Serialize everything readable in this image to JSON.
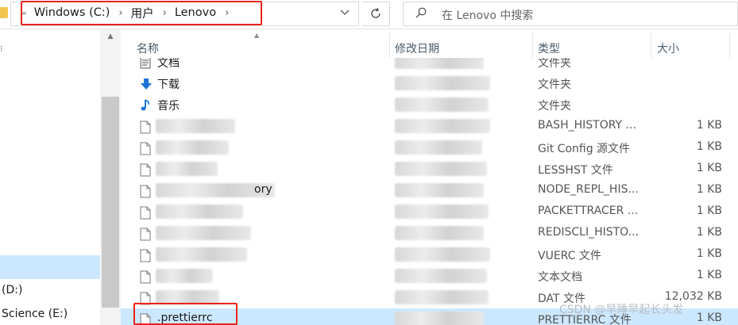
{
  "address": {
    "breadcrumbs": [
      "Windows (C:)",
      "用户",
      "Lenovo"
    ]
  },
  "search": {
    "placeholder": "在 Lenovo 中搜索"
  },
  "nav": {
    "items": [
      {
        "label": "(D:)"
      },
      {
        "label": "Science (E:)"
      }
    ]
  },
  "columns": {
    "name": "名称",
    "date": "修改日期",
    "type": "类型",
    "size": "大小"
  },
  "files": [
    {
      "name": "文档",
      "date": "",
      "type": "文件夹",
      "size": "",
      "icon": "documents-icon"
    },
    {
      "name": "下载",
      "date": "",
      "type": "文件夹",
      "size": "",
      "icon": "download-arrow-icon"
    },
    {
      "name": "音乐",
      "date": "",
      "type": "文件夹",
      "size": "",
      "icon": "music-note-icon"
    },
    {
      "name": "",
      "date": "",
      "type": "BASH_HISTORY ...",
      "size": "1 KB",
      "icon": "file-icon"
    },
    {
      "name": "",
      "date": "",
      "type": "Git Config 源文件",
      "size": "1 KB",
      "icon": "file-icon"
    },
    {
      "name": "",
      "date": "",
      "type": "LESSHST 文件",
      "size": "1 KB",
      "icon": "file-icon"
    },
    {
      "name": "ory",
      "date": "",
      "type": "NODE_REPL_HIS...",
      "size": "1 KB",
      "icon": "file-icon"
    },
    {
      "name": "",
      "date": "",
      "type": "PACKETTRACER ...",
      "size": "1 KB",
      "icon": "file-icon"
    },
    {
      "name": "",
      "date": "",
      "type": "REDISCLI_HISTO...",
      "size": "1 KB",
      "icon": "file-icon"
    },
    {
      "name": "",
      "date": "",
      "type": "VUERC 文件",
      "size": "1 KB",
      "icon": "file-icon"
    },
    {
      "name": "",
      "date": "",
      "type": "文本文档",
      "size": "1 KB",
      "icon": "file-icon"
    },
    {
      "name": "",
      "date": "",
      "type": "DAT 文件",
      "size": "12,032 KB",
      "icon": "file-icon"
    },
    {
      "name": ".prettierrc",
      "date": "",
      "type": "PRETTIERRC 文件",
      "size": "1 KB",
      "icon": "file-icon",
      "selected": true
    }
  ],
  "watermark": "CSDN @早睡早起长头发",
  "colors": {
    "highlight_red": "#e8231b",
    "selection_blue": "#cce8ff",
    "folder_yellow": "#f3c74f",
    "download_blue": "#1e74d6"
  }
}
